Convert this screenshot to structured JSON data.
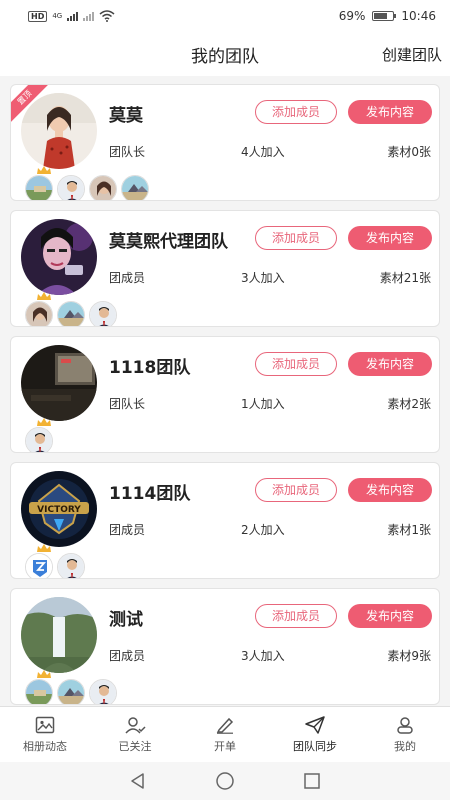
{
  "status": {
    "hd": "HD",
    "network": "4G",
    "battery": "69%",
    "battery_level": 0.69,
    "time": "10:46"
  },
  "header": {
    "title": "我的团队",
    "action": "创建团队"
  },
  "buttons": {
    "add_member": "添加成员",
    "publish": "发布内容"
  },
  "ribbon": "置顶",
  "teams": [
    {
      "name": "莫莫",
      "role": "团队长",
      "joined": "4人加入",
      "materials": "素材0张",
      "avatar": "woman-red-dress"
    },
    {
      "name": "莫莫熙代理团队",
      "role": "团成员",
      "joined": "3人加入",
      "materials": "素材21张",
      "avatar": "stylized-woman-purple"
    },
    {
      "name": "1118团队",
      "role": "团队长",
      "joined": "1人加入",
      "materials": "素材2张",
      "avatar": "dark-monitor"
    },
    {
      "name": "1114团队",
      "role": "团成员",
      "joined": "2人加入",
      "materials": "素材1张",
      "avatar": "victory-badge"
    },
    {
      "name": "测试",
      "role": "团成员",
      "joined": "3人加入",
      "materials": "素材9张",
      "avatar": "waterfall"
    }
  ],
  "tabs": [
    {
      "label": "相册动态",
      "icon": "image-icon"
    },
    {
      "label": "已关注",
      "icon": "follow-icon"
    },
    {
      "label": "开单",
      "icon": "pencil-icon"
    },
    {
      "label": "团队同步",
      "icon": "send-icon"
    },
    {
      "label": "我的",
      "icon": "person-icon"
    }
  ],
  "colors": {
    "accent": "#ee5c72",
    "accent_outline": "#e8667b"
  }
}
